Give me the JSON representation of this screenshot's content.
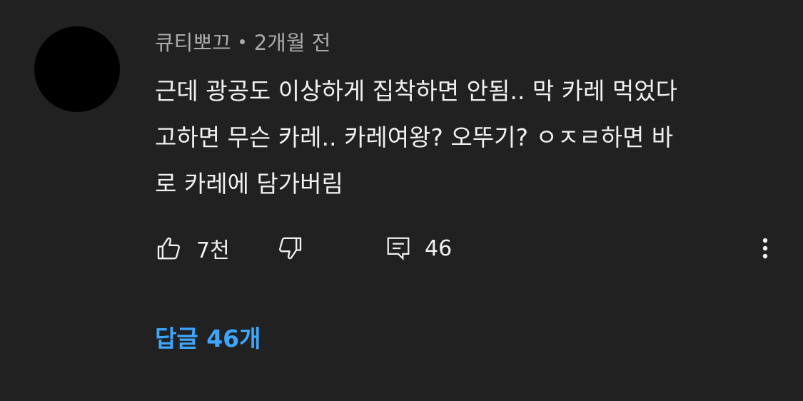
{
  "comment": {
    "author": "큐티뽀끄",
    "time": "2개월 전",
    "lines": [
      "근데 광공도 이상하게 집착하면 안됨.. 막 카레 먹었다",
      "고하면 무슨 카레.. 카레여왕? 오뚜기? ㅇㅈㄹ하면 바",
      "로 카레에 담가버림"
    ]
  },
  "actions": {
    "like_count": "7천",
    "reply_count": "46"
  },
  "replies": {
    "label": "답글 46개"
  },
  "colors": {
    "background": "#212121",
    "text": "#f1f1f1",
    "secondary_text": "#aaaaaa",
    "link": "#3ea6ff"
  },
  "icons": {
    "like": "thumbs-up-icon",
    "dislike": "thumbs-down-icon",
    "reply": "comment-icon",
    "more": "more-vert-icon"
  }
}
